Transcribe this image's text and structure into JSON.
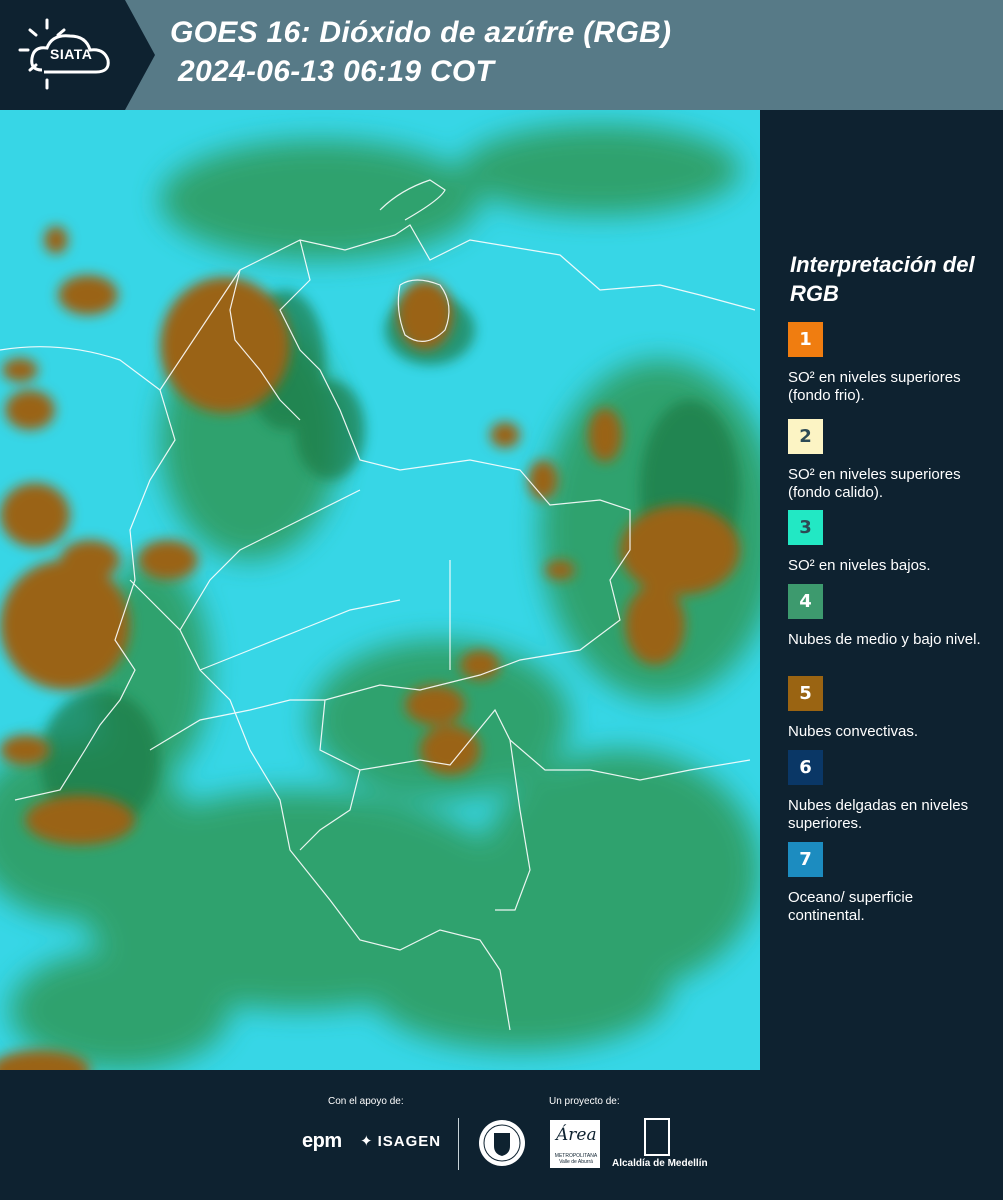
{
  "header": {
    "logo_text": "SIATA",
    "title": "GOES 16: Dióxido de azúfre (RGB)",
    "datetime": "2024-06-13 06:19 COT"
  },
  "legend": {
    "title": "Interpretación del RGB",
    "items": [
      {
        "number": "1",
        "label": "SO² en niveles superiores (fondo frio).",
        "color": "#f07d10"
      },
      {
        "number": "2",
        "label": "SO² en niveles superiores (fondo calido).",
        "color": "#fcf4c4"
      },
      {
        "number": "3",
        "label": "SO² en niveles bajos.",
        "color": "#22e8c4"
      },
      {
        "number": "4",
        "label": "Nubes de medio y bajo nivel.",
        "color": "#3d9a6e"
      },
      {
        "number": "5",
        "label": "Nubes convectivas.",
        "color": "#9a6412"
      },
      {
        "number": "6",
        "label": "Nubes delgadas en niveles superiores.",
        "color": "#0a3766"
      },
      {
        "number": "7",
        "label": "Oceano/ superficie continental.",
        "color": "#1c8cc0"
      }
    ]
  },
  "footer": {
    "support_label": "Con el apoyo de:",
    "project_label": "Un proyecto de:",
    "epm": "epm",
    "isagen": "ISAGEN",
    "area_name": "Área",
    "area_sub": "METROPOLITANA Valle de Aburrá",
    "alcaldia": "Alcaldía de Medellín"
  },
  "map": {
    "background_color": "#37d6e6",
    "cloud_color": "#9a6412",
    "vegetation_color": "#2e9a5a"
  }
}
